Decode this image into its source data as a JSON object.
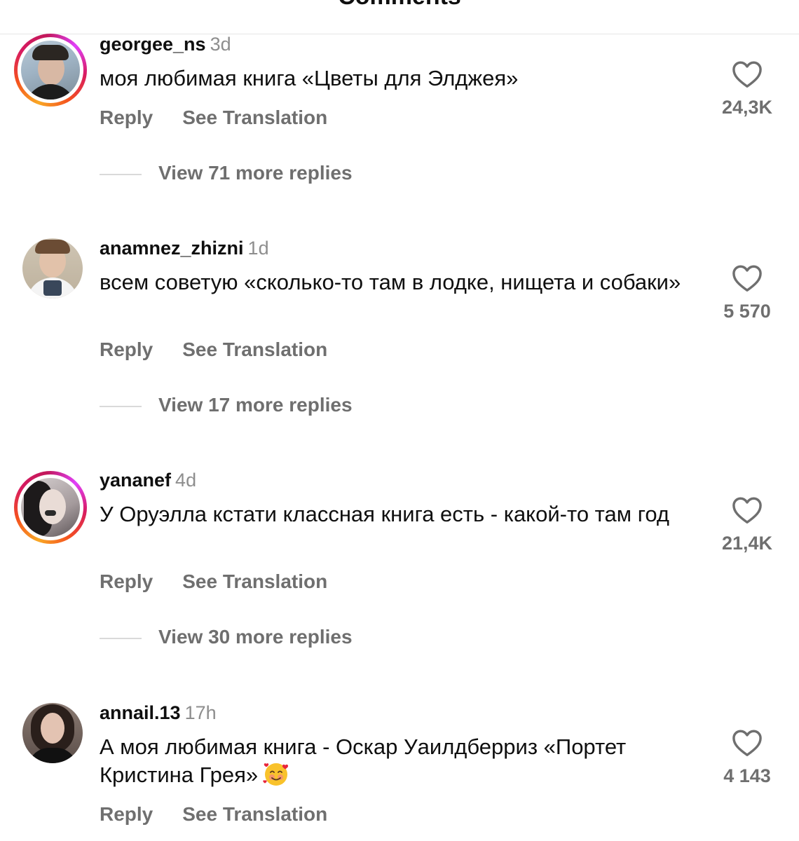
{
  "header": {
    "title": "Comments"
  },
  "comments": [
    {
      "username": "georgee_ns",
      "time": "3d",
      "text": "моя любимая книга «Цветы для Элджея»",
      "reply_label": "Reply",
      "translate_label": "See Translation",
      "likes": "24,3K",
      "more_replies": "View 71 more replies",
      "has_story": true
    },
    {
      "username": "anamnez_zhizni",
      "time": "1d",
      "text": "всем советую «сколько-то там в лодке, нищета и собаки»",
      "reply_label": "Reply",
      "translate_label": "See Translation",
      "likes": "5 570",
      "more_replies": "View 17 more replies",
      "has_story": false
    },
    {
      "username": "yananef",
      "time": "4d",
      "text": "У Оруэлла кстати классная книга есть - какой-то там год",
      "reply_label": "Reply",
      "translate_label": "See Translation",
      "likes": "21,4K",
      "more_replies": "View 30 more replies",
      "has_story": true
    },
    {
      "username": "annail.13",
      "time": "17h",
      "text": "А моя любимая книга - Оскар Уаилдберриз «Портет Кристина Грея»",
      "emoji": "smiling-face-with-hearts",
      "reply_label": "Reply",
      "translate_label": "See Translation",
      "likes": "4 143",
      "has_story": false
    }
  ],
  "colors": {
    "text_primary": "#0f0f0f",
    "text_secondary": "#6f6f6f",
    "timestamp": "#8e8e8e",
    "divider": "#e6e6e6"
  }
}
